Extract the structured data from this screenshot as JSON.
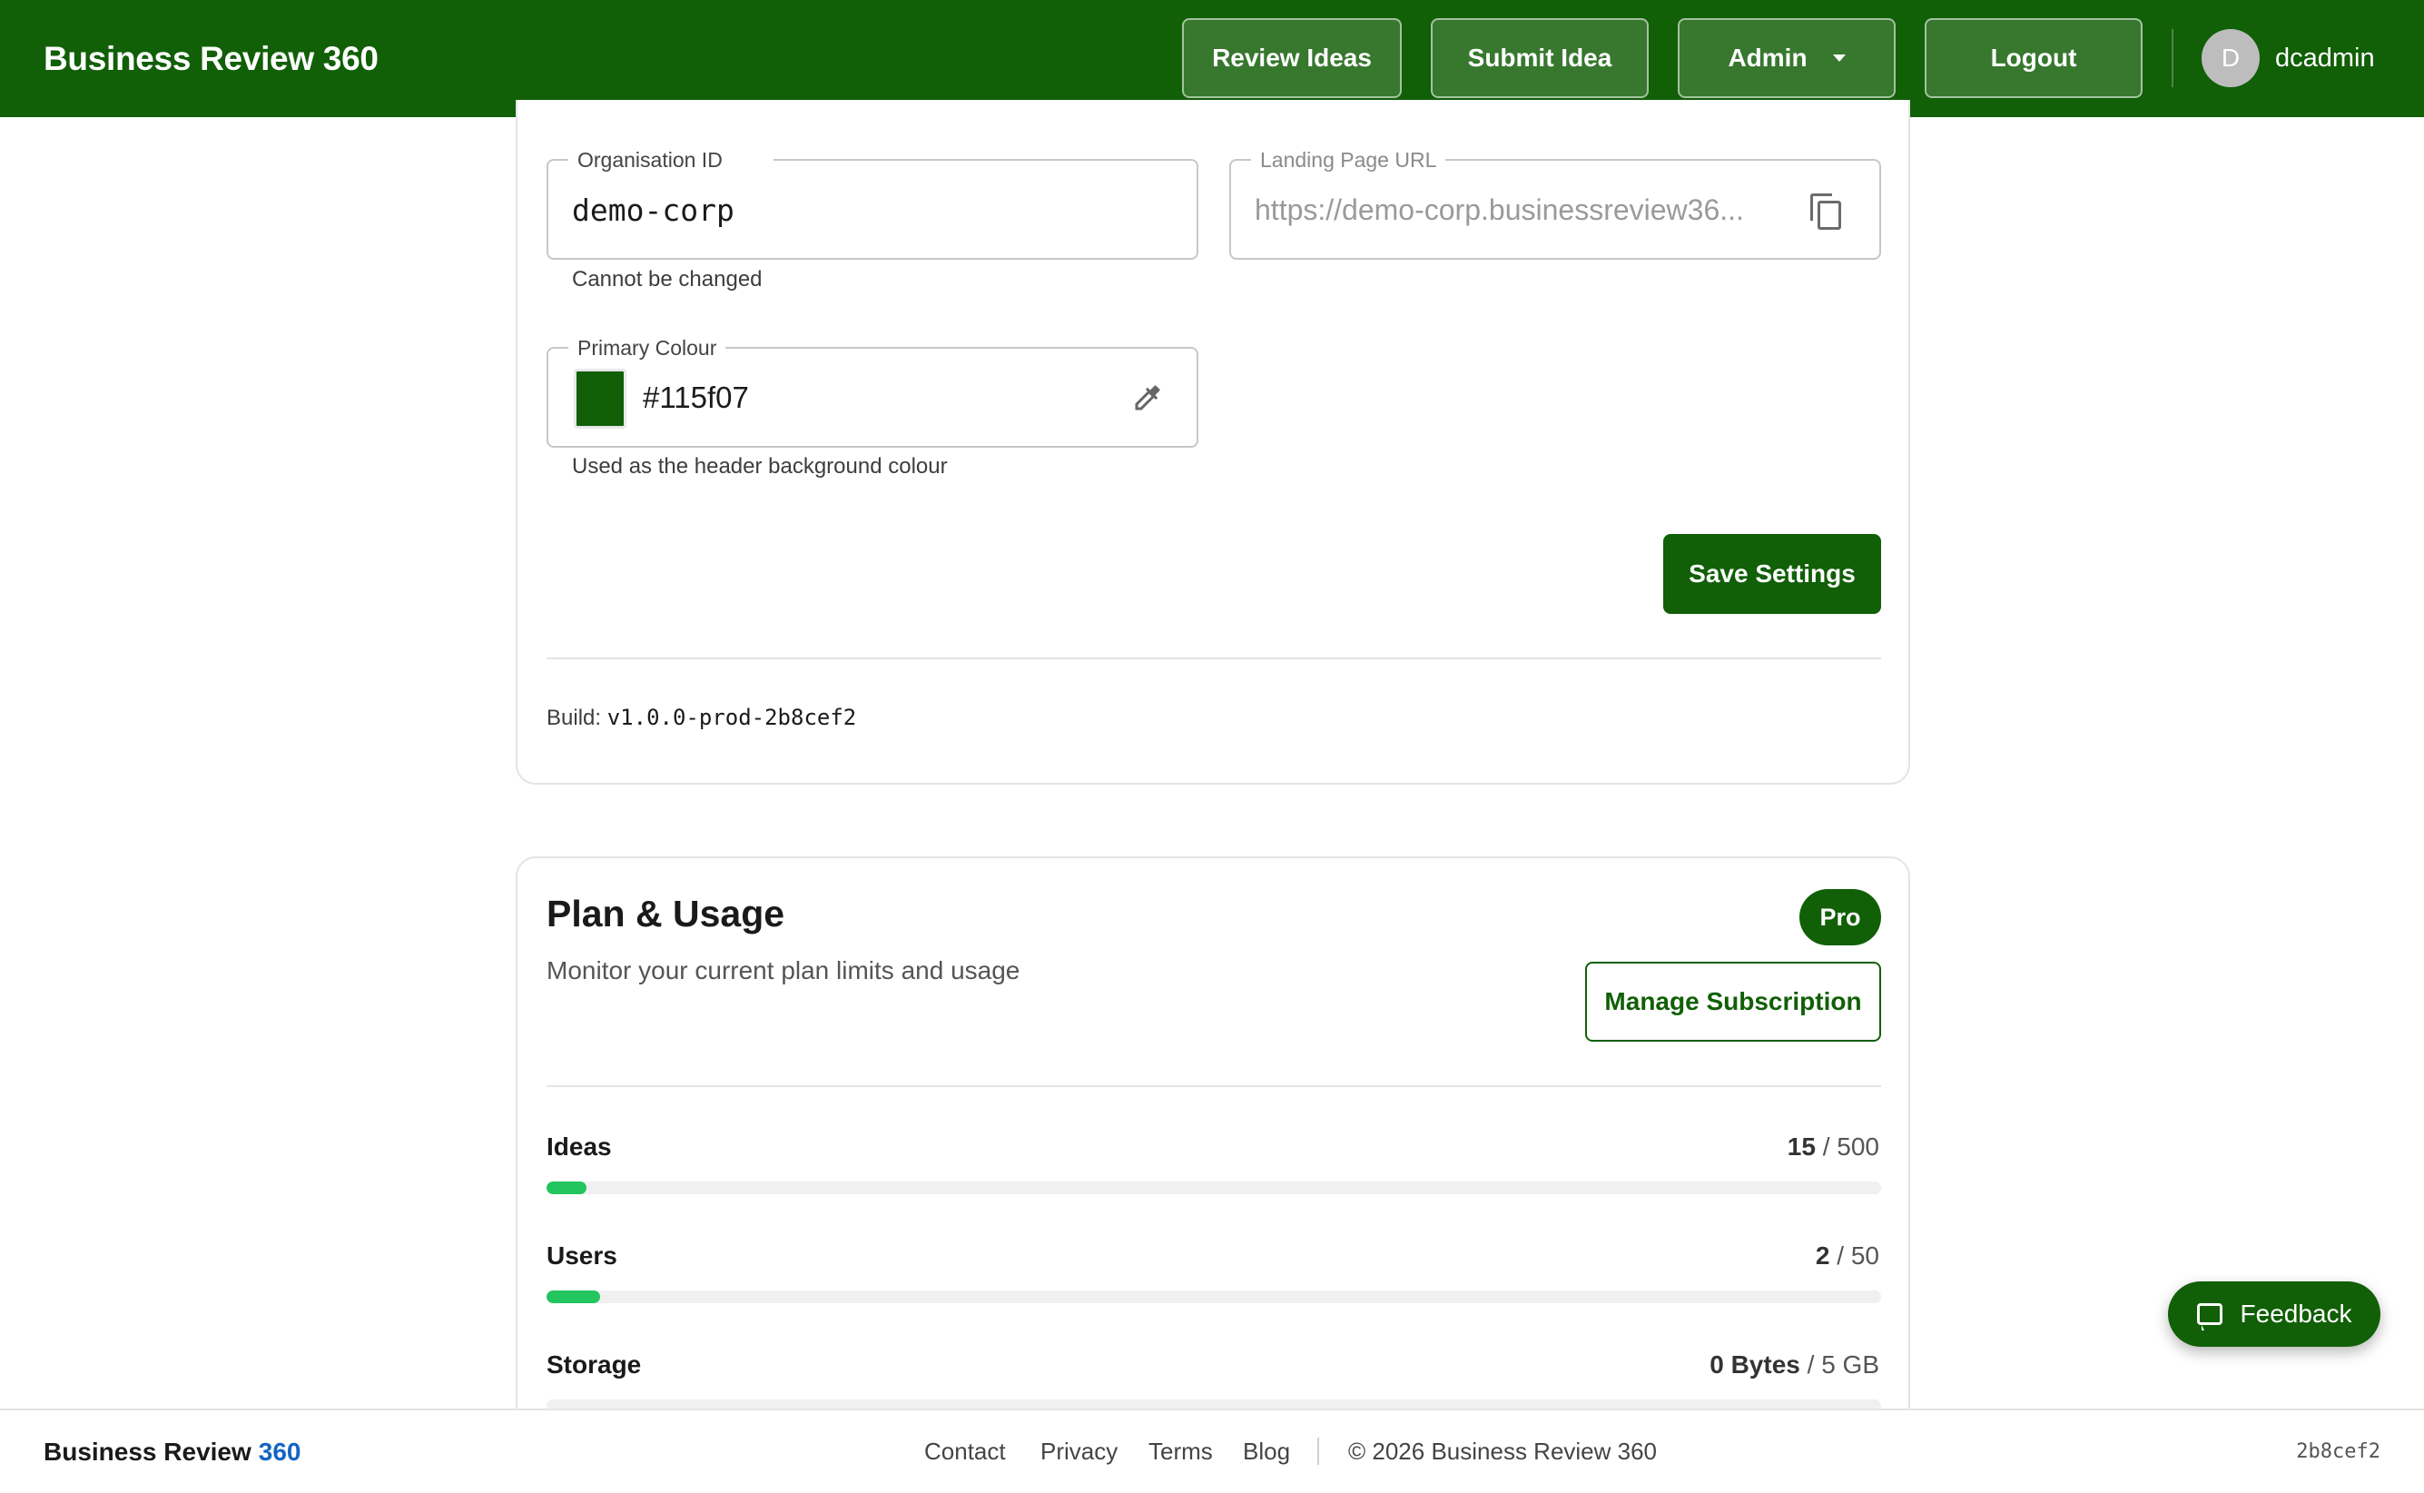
{
  "header": {
    "brand": "Business Review 360",
    "nav": {
      "review_ideas": "Review Ideas",
      "submit_idea": "Submit Idea",
      "admin": "Admin",
      "logout": "Logout"
    },
    "user": {
      "initial": "D",
      "name": "dcadmin"
    },
    "background_color": "#115f07"
  },
  "settings": {
    "org_id": {
      "label": "Organisation ID",
      "value": "demo-corp",
      "helper": "Cannot be changed"
    },
    "landing_url": {
      "label": "Landing Page URL",
      "value": "https://demo-corp.businessreview36...",
      "icon": "copy-icon"
    },
    "primary_colour": {
      "label": "Primary Colour",
      "value": "#115f07",
      "helper": "Used as the header background colour",
      "icon": "eyedropper-icon"
    },
    "save_label": "Save Settings",
    "build_label": "Build:",
    "build_version": "v1.0.0-prod-2b8cef2"
  },
  "plan": {
    "title": "Plan & Usage",
    "subtitle": "Monitor your current plan limits and usage",
    "badge": "Pro",
    "manage_label": "Manage Subscription",
    "usage": [
      {
        "label": "Ideas",
        "used": "15",
        "limit": "500",
        "fraction": 0.03
      },
      {
        "label": "Users",
        "used": "2",
        "limit": "50",
        "fraction": 0.04
      },
      {
        "label": "Storage",
        "used": "0 Bytes",
        "limit": "5 GB",
        "fraction": 0.0
      }
    ],
    "separator": "/",
    "bar_color": "#22c55e"
  },
  "feedback": {
    "label": "Feedback",
    "icon": "chat-icon"
  },
  "footer": {
    "brand_main": "Business Review",
    "brand_accent": "360",
    "links": [
      "Contact",
      "Privacy",
      "Terms",
      "Blog"
    ],
    "copyright": "© 2026 Business Review 360",
    "hash": "2b8cef2"
  }
}
